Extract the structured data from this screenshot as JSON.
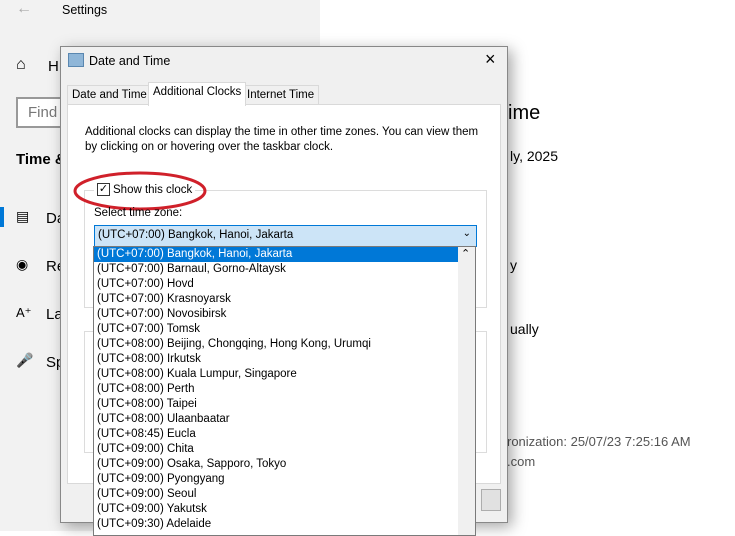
{
  "settings": {
    "title": "Settings",
    "sidebar_fragments": {
      "home": "H",
      "search": "Find",
      "section": "Time &",
      "date_time": "Da",
      "region": "Re",
      "language": "La",
      "speech": "Sp"
    },
    "right_fragments": {
      "heading": "ime",
      "date": "ly, 2025",
      "line1": "y",
      "line2": "ually",
      "sync": "ronization: 25/07/23 7:25:16 AM",
      "server": ".com"
    }
  },
  "dialog": {
    "title": "Date and Time",
    "tabs": [
      "Date and Time",
      "Additional Clocks",
      "Internet Time"
    ],
    "active_tab": 1,
    "description": "Additional clocks can display the time in other time zones. You can view them by clicking on or hovering over the taskbar clock.",
    "show_clock_label": "Show this clock",
    "show_clock_checked": true,
    "select_label": "Select time zone:",
    "selected_zone": "(UTC+07:00) Bangkok, Hanoi, Jakarta",
    "zone_options": [
      "(UTC+07:00) Bangkok, Hanoi, Jakarta",
      "(UTC+07:00) Barnaul, Gorno-Altaysk",
      "(UTC+07:00) Hovd",
      "(UTC+07:00) Krasnoyarsk",
      "(UTC+07:00) Novosibirsk",
      "(UTC+07:00) Tomsk",
      "(UTC+08:00) Beijing, Chongqing, Hong Kong, Urumqi",
      "(UTC+08:00) Irkutsk",
      "(UTC+08:00) Kuala Lumpur, Singapore",
      "(UTC+08:00) Perth",
      "(UTC+08:00) Taipei",
      "(UTC+08:00) Ulaanbaatar",
      "(UTC+08:45) Eucla",
      "(UTC+09:00) Chita",
      "(UTC+09:00) Osaka, Sapporo, Tokyo",
      "(UTC+09:00) Pyongyang",
      "(UTC+09:00) Seoul",
      "(UTC+09:00) Yakutsk",
      "(UTC+09:30) Adelaide"
    ],
    "highlight_color": "#0078d7",
    "annotation_color": "#d0202a"
  }
}
